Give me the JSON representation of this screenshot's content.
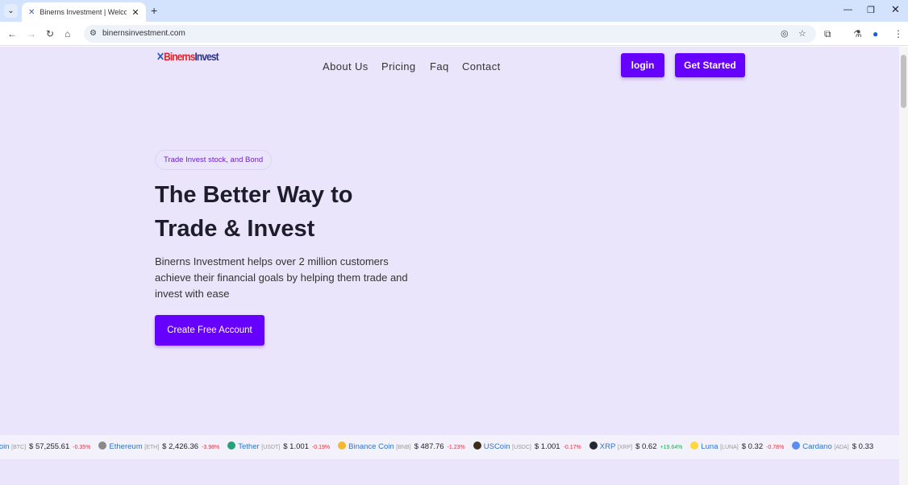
{
  "browser": {
    "tab_title": "Binerns Investment | Welcome",
    "url": "binernsinvestment.com"
  },
  "header": {
    "logo_a": "Binerns",
    "logo_b": "Invest",
    "menu": [
      "About Us",
      "Pricing",
      "Faq",
      "Contact"
    ],
    "login": "login",
    "get_started": "Get Started"
  },
  "hero": {
    "badge": "Trade Invest stock, and Bond",
    "title_line1": "The Better Way to",
    "title_line2": "Trade & Invest",
    "description": "Binerns Investment helps over 2 million customers achieve their financial goals by helping them trade and invest with ease",
    "cta": "Create Free Account"
  },
  "accent": "#6600ff",
  "ticker": [
    {
      "name": "Bitcoin",
      "sym": "[BTC]",
      "price": "$ 57,255.61",
      "change": "-0.35%",
      "color": "#f7931a",
      "up": false
    },
    {
      "name": "Ethereum",
      "sym": "[ETH]",
      "price": "$ 2,426.36",
      "change": "-3.98%",
      "color": "#8a8a8a",
      "up": false
    },
    {
      "name": "Tether",
      "sym": "[USDT]",
      "price": "$ 1.001",
      "change": "-0.19%",
      "color": "#26a17b",
      "up": false
    },
    {
      "name": "Binance Coin",
      "sym": "[BNB]",
      "price": "$ 487.76",
      "change": "-1.23%",
      "color": "#f3ba2f",
      "up": false
    },
    {
      "name": "USCoin",
      "sym": "[USDC]",
      "price": "$ 1.001",
      "change": "-0.17%",
      "color": "#3a2e1a",
      "up": false
    },
    {
      "name": "XRP",
      "sym": "[XRP]",
      "price": "$ 0.62",
      "change": "+19.64%",
      "color": "#23292f",
      "up": true
    },
    {
      "name": "Luna",
      "sym": "[LUNA]",
      "price": "$ 0.32",
      "change": "-0.78%",
      "color": "#ffd83d",
      "up": false
    },
    {
      "name": "Cardano",
      "sym": "[ADA]",
      "price": "$ 0.33",
      "change": "",
      "color": "#5b8def",
      "up": false
    }
  ]
}
